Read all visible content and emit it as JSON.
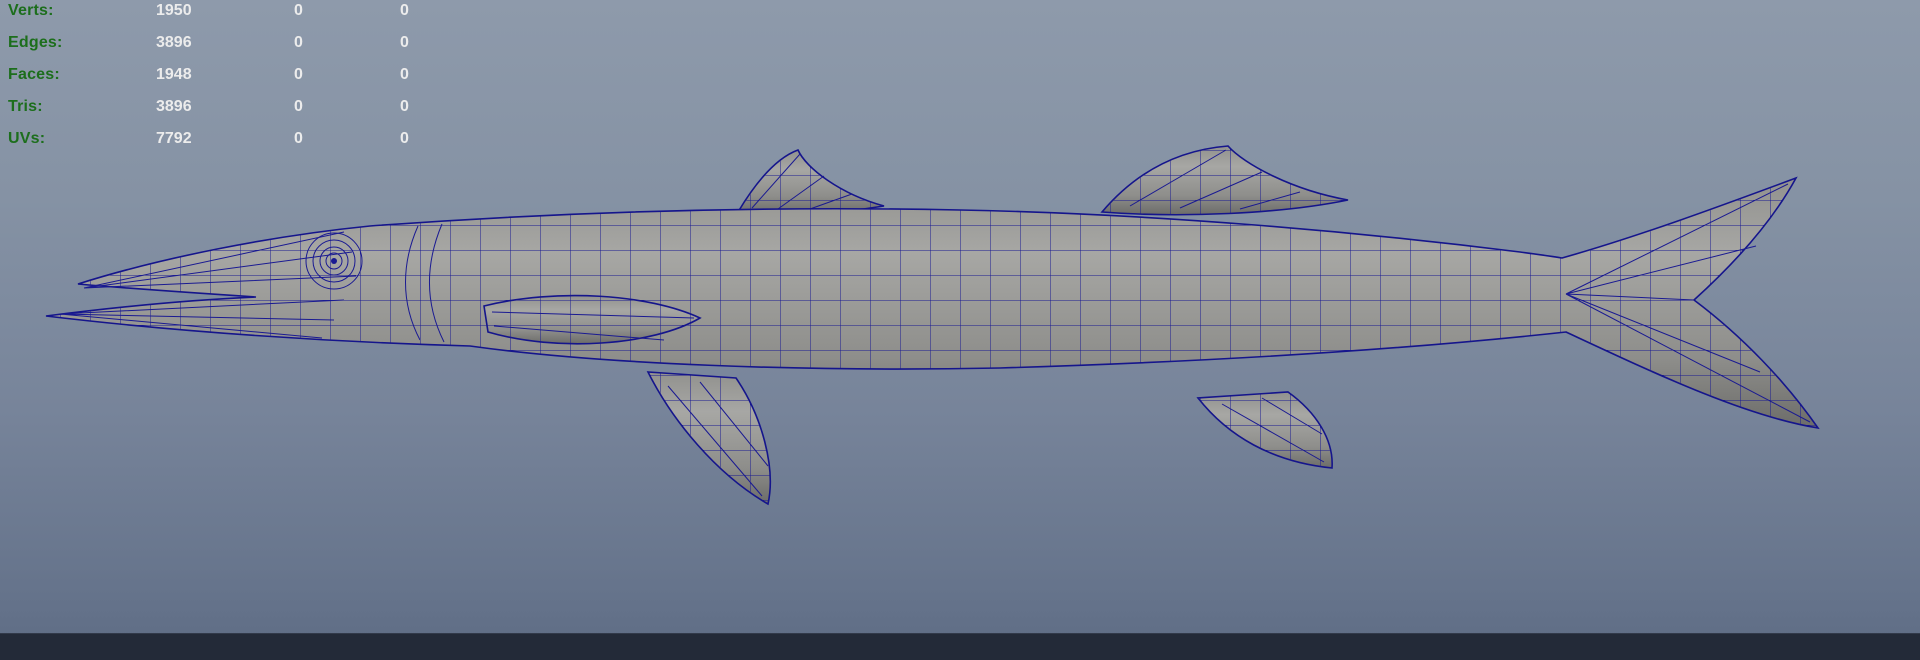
{
  "hud": {
    "rows": [
      {
        "label": "Verts:",
        "total": "1950",
        "selected": "0",
        "other": "0"
      },
      {
        "label": "Edges:",
        "total": "3896",
        "selected": "0",
        "other": "0"
      },
      {
        "label": "Faces:",
        "total": "1948",
        "selected": "0",
        "other": "0"
      },
      {
        "label": "Tris:",
        "total": "3896",
        "selected": "0",
        "other": "0"
      },
      {
        "label": "UVs:",
        "total": "7792",
        "selected": "0",
        "other": "0"
      }
    ]
  },
  "colors": {
    "hud_label": "#1c6e1c",
    "hud_value": "#ececec",
    "wireframe": "#15158c",
    "model_gray": "#9a9a97",
    "background_top": "#8e9aab",
    "background_bottom": "#5d6b83",
    "bottom_bar": "#232a38"
  }
}
